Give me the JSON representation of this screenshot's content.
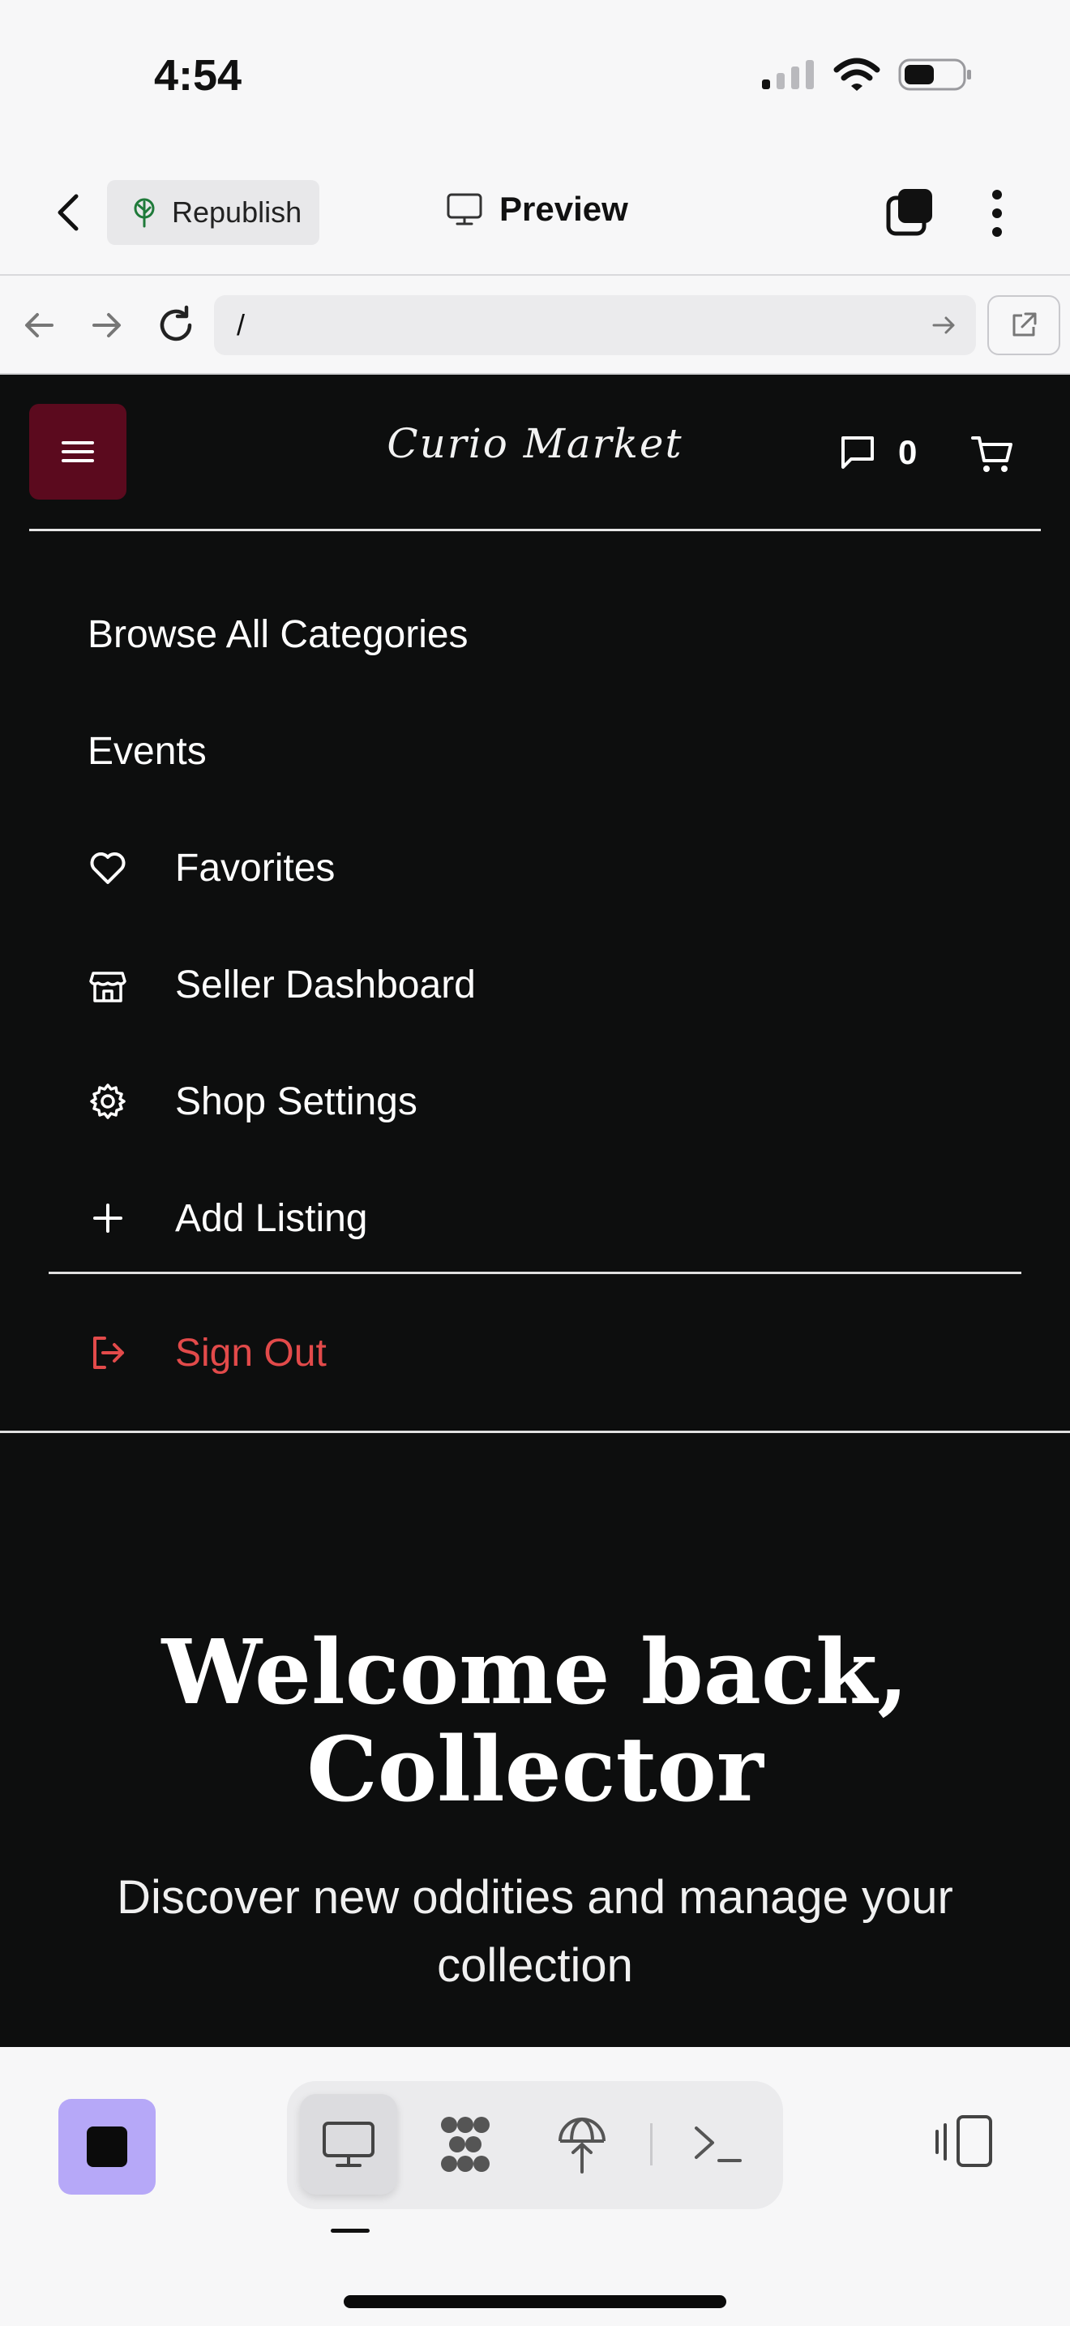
{
  "status_bar": {
    "time": "4:54",
    "icons": [
      "signal-icon",
      "wifi-icon",
      "battery-icon"
    ]
  },
  "app_header": {
    "back_icon": "chevron-left-icon",
    "republish_label": "Republish",
    "republish_icon": "tree-icon",
    "preview_label": "Preview",
    "preview_icon": "monitor-icon",
    "tabs_icon": "tabs-icon",
    "more_icon": "more-vertical-icon"
  },
  "browser": {
    "url": "/",
    "icons": [
      "arrow-left-icon",
      "arrow-right-icon",
      "reload-icon",
      "go-arrow-icon",
      "external-link-icon"
    ]
  },
  "site": {
    "brand": "Curio Market",
    "message_count": "0",
    "colors": {
      "background": "#0d0e0e",
      "menu_button": "#5b0a1e",
      "sign_out": "#e24a4a"
    },
    "menu": {
      "browse": "Browse All Categories",
      "events": "Events",
      "favorites": "Favorites",
      "seller_dashboard": "Seller Dashboard",
      "shop_settings": "Shop Settings",
      "add_listing": "Add Listing",
      "sign_out": "Sign Out"
    },
    "hero": {
      "title_line1": "Welcome back,",
      "title_line2": "Collector",
      "subtitle": "Discover new oddities and manage your collection"
    }
  },
  "toolbar": {
    "stop_color": "#b6a8f8",
    "tools": [
      "monitor-icon",
      "apps-icon",
      "deploy-icon",
      "terminal-icon"
    ],
    "active_tool": "monitor-icon",
    "device_icon": "device-toggle-icon"
  }
}
